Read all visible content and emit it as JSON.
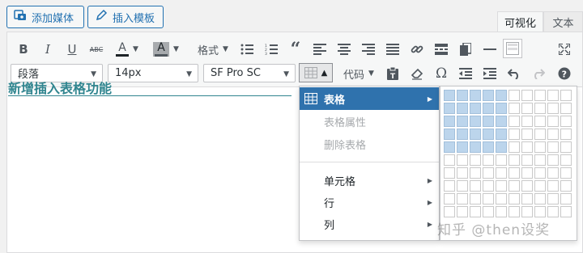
{
  "media_buttons": {
    "add_media": "添加媒体",
    "insert_template": "插入模板"
  },
  "tabs": {
    "visual": "可视化",
    "text": "文本"
  },
  "toolbar": {
    "format_label": "格式",
    "code_label": "代码",
    "paragraph_select": "段落",
    "font_size_select": "14px",
    "font_family_select": "SF Pro SC"
  },
  "content": {
    "heading": "新增插入表格功能"
  },
  "table_menu": {
    "items": [
      {
        "label": "表格",
        "state": "active",
        "submenu": true
      },
      {
        "label": "表格属性",
        "state": "disabled",
        "submenu": false
      },
      {
        "label": "删除表格",
        "state": "disabled",
        "submenu": false
      },
      {
        "label": "单元格",
        "state": "normal",
        "submenu": true
      },
      {
        "label": "行",
        "state": "normal",
        "submenu": true
      },
      {
        "label": "列",
        "state": "normal",
        "submenu": true
      }
    ]
  },
  "table_grid": {
    "rows": 10,
    "cols": 10,
    "selected_rows": 5,
    "selected_cols": 5
  },
  "watermark": "知乎 @then设奖",
  "colors": {
    "accent": "#2f72ad",
    "heading": "#30858f",
    "grid_selected": "#bcd5ec"
  }
}
